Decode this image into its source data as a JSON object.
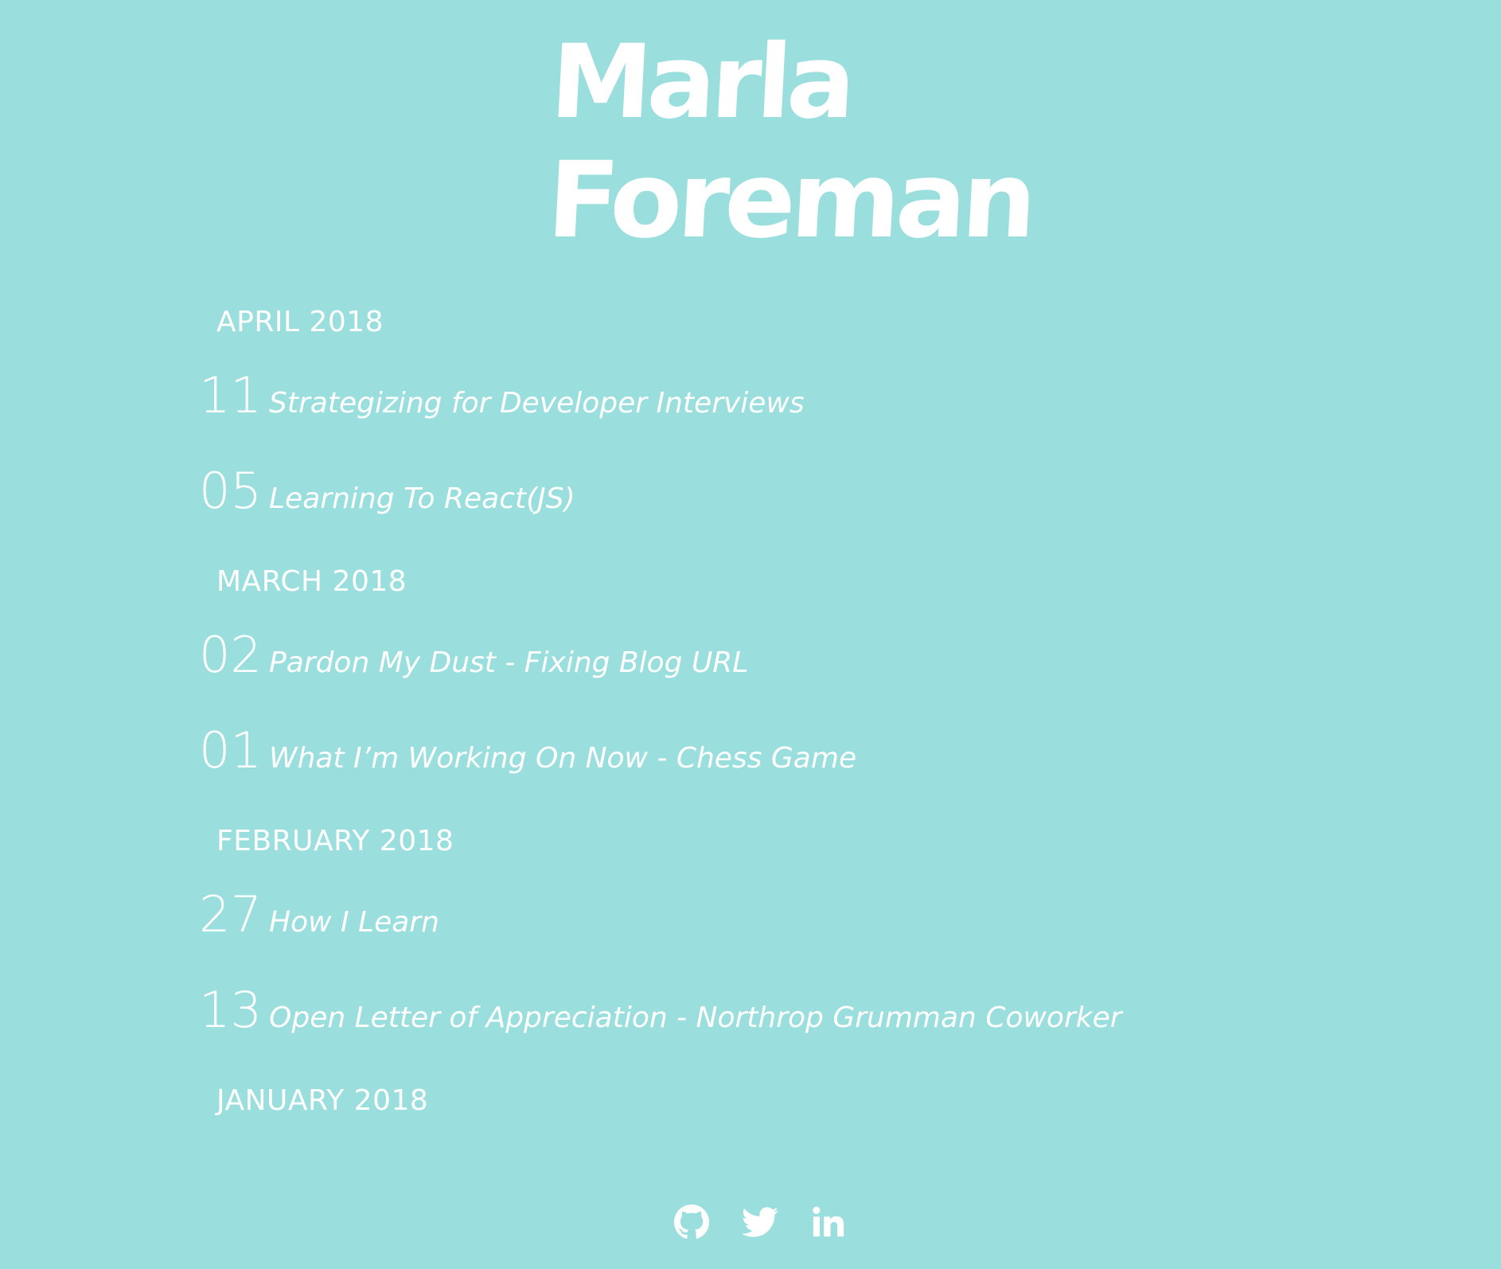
{
  "header": {
    "logo_line1": "Marla",
    "logo_line2": "Foreman"
  },
  "archive": [
    {
      "month": "APRIL 2018",
      "posts": [
        {
          "day": "11",
          "title": "Strategizing for Developer Interviews"
        },
        {
          "day": "05",
          "title": "Learning To React(JS)"
        }
      ]
    },
    {
      "month": "MARCH 2018",
      "posts": [
        {
          "day": "02",
          "title": "Pardon My Dust - Fixing Blog URL"
        },
        {
          "day": "01",
          "title": "What I’m Working On Now - Chess Game"
        }
      ]
    },
    {
      "month": "FEBRUARY 2018",
      "posts": [
        {
          "day": "27",
          "title": "How I Learn"
        },
        {
          "day": "13",
          "title": "Open Letter of Appreciation - Northrop Grumman Coworker"
        }
      ]
    },
    {
      "month": "JANUARY 2018",
      "posts": []
    }
  ],
  "social": [
    {
      "icon": "github-icon"
    },
    {
      "icon": "twitter-icon"
    },
    {
      "icon": "linkedin-icon"
    }
  ],
  "colors": {
    "background": "#9bdede",
    "text": "#ffffff"
  }
}
